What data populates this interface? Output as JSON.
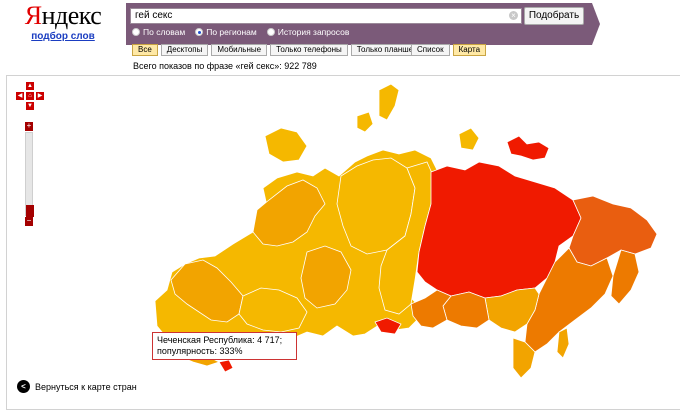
{
  "logo": {
    "text_y": "Я",
    "text_rest": "ндекс",
    "subtitle": "подбор слов"
  },
  "search": {
    "query": "гей секс",
    "submit_label": "Подобрать",
    "modes": [
      {
        "label": "По словам",
        "selected": false
      },
      {
        "label": "По регионам",
        "selected": true
      },
      {
        "label": "История запросов",
        "selected": false
      }
    ]
  },
  "filters": [
    {
      "label": "Все",
      "active": true
    },
    {
      "label": "Десктопы",
      "active": false
    },
    {
      "label": "Мобильные",
      "active": false
    },
    {
      "label": "Только телефоны",
      "active": false
    },
    {
      "label": "Только планшеты",
      "active": false
    }
  ],
  "views": [
    {
      "label": "Список",
      "active": false
    },
    {
      "label": "Карта",
      "active": true
    }
  ],
  "summary": {
    "total_text": "Всего показов по фразе «гей секс»: 922 789"
  },
  "tooltip": {
    "line1": "Чеченская Республика: 4 717;",
    "line2": "популярность: 333%"
  },
  "back_link": {
    "label": "Вернуться к карте стран"
  },
  "map": {
    "colors": {
      "yellow": "#f5b800",
      "amber": "#f2a400",
      "orange": "#ed7a00",
      "dark_orange": "#e95e10",
      "red": "#f01a00"
    }
  }
}
